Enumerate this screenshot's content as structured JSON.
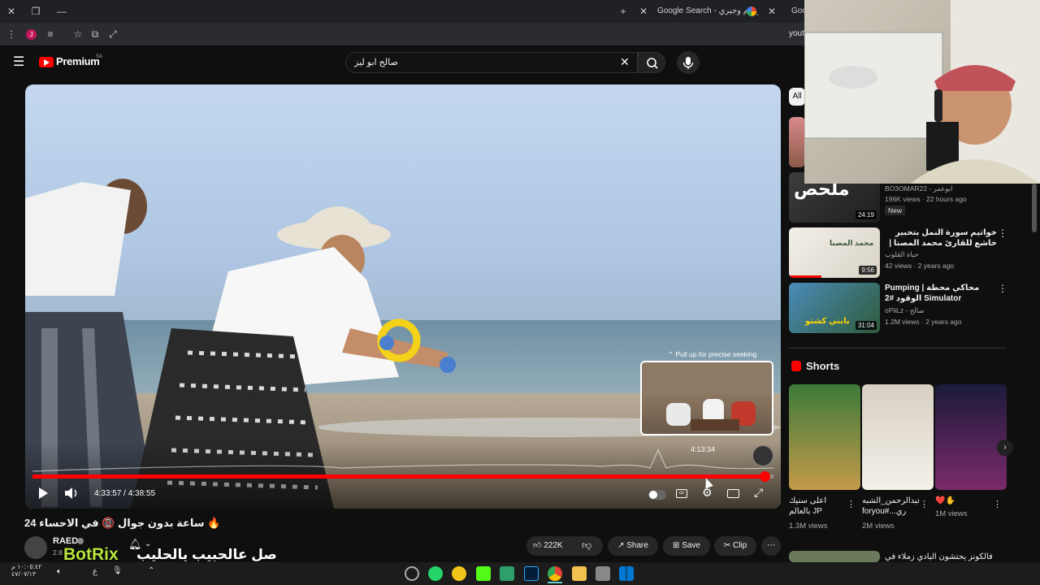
{
  "browser": {
    "tabs": [
      {
        "label": "Google Search - فار توم وجيري"
      },
      {
        "label": "Goo"
      }
    ],
    "url": "yout"
  },
  "youtube": {
    "logo": "Premium",
    "region": "SA",
    "search_value": "صالح ابو ليز"
  },
  "player": {
    "time_current": "4:33:57",
    "time_sep": "/",
    "time_total": "4:38:55",
    "preview_hint": "⌃ Pull up for precise seeking",
    "preview_time": "4:13:34",
    "progress_fraction": 0.988
  },
  "video": {
    "title": "24 ساعة بدون جوال 📵 في الاحساء 🔥",
    "channel": "RAED",
    "subs": "2.8",
    "likes": "222K",
    "share": "Share",
    "save": "Save",
    "clip": "Clip"
  },
  "overlay": {
    "botrix": "BotRix",
    "caption": "صل عالحبيب يالحليب"
  },
  "sidebar": {
    "chip": "All",
    "items": [
      {
        "title": "",
        "channel": "BO3OMAR22 - ابوعمر",
        "meta": "196K views · 22 hours ago",
        "badge": "New",
        "duration": "24:19",
        "thumb_text": "ملحص"
      },
      {
        "title": "خواتيم سورة النمل بتحبير خاشع للقارئ محمد المصنا | من الليلة الرابعة والعشرون من ليالي...",
        "channel": "حياة القلوب",
        "meta": "42 views · 2 years ago",
        "badge": "",
        "duration": "9:56",
        "thumb_text": "محمد المصنا"
      },
      {
        "title": "Pumping | محاكي محطة الوقود #2 Simulator",
        "channel": "oPiiLz - صالح",
        "meta": "1.2M views · 2 years ago",
        "badge": "",
        "duration": "31:04",
        "thumb_text": "بابني كشتو"
      }
    ],
    "shorts_label": "Shorts",
    "shorts": [
      {
        "title": "اعلى سنيك بالعالم JP",
        "views": "1.3M views"
      },
      {
        "title": "عبدالرحمن_الشبه# foryou#...ري",
        "views": "2M views"
      },
      {
        "title": "❤️✋",
        "views": "1M views"
      }
    ],
    "next_title": "فالكونز يحتشون البادي زملاء في حان..."
  },
  "taskbar": {
    "clock_time": "١٠:٠٥:٤٢ م",
    "clock_date": "٤٧/٠٧/١٣",
    "lang": "ع"
  },
  "colors": {
    "accent": "#ff0000",
    "bg": "#0f0f0f"
  }
}
